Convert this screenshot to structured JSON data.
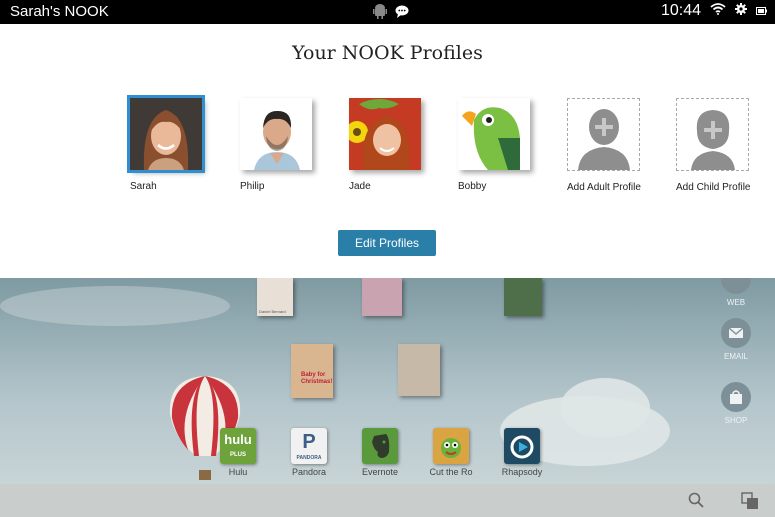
{
  "status_bar": {
    "device_name": "Sarah's NOOK",
    "time": "10:44"
  },
  "profiles_panel": {
    "heading": "Your NOOK Profiles",
    "profiles": [
      {
        "name": "Sarah",
        "selected": true
      },
      {
        "name": "Philip"
      },
      {
        "name": "Jade"
      },
      {
        "name": "Bobby"
      },
      {
        "name": "Add Adult Profile"
      },
      {
        "name": "Add Child Profile"
      }
    ],
    "edit_button_label": "Edit Profiles"
  },
  "home": {
    "magazine_cover_text": [
      "Baby for Christmas!",
      "Daniel Bernard"
    ],
    "apps": [
      {
        "label": "Hulu",
        "icon_text": "hulu",
        "icon_subtext": "PLUS"
      },
      {
        "label": "Pandora",
        "icon_text": "P",
        "icon_subtext": "PANDORA"
      },
      {
        "label": "Evernote"
      },
      {
        "label": "Cut the Ro"
      },
      {
        "label": "Rhapsody"
      }
    ],
    "side_shortcuts": [
      "WEB",
      "EMAIL",
      "SHOP"
    ]
  },
  "icons": [
    "android-icon",
    "chat-icon",
    "wifi-icon",
    "settings-icon",
    "battery-icon",
    "search-icon",
    "recent-apps-icon"
  ],
  "colors": {
    "accent": "#2a7fa9",
    "selected_outline": "#2f8fd0",
    "status_bar": "#000000"
  }
}
